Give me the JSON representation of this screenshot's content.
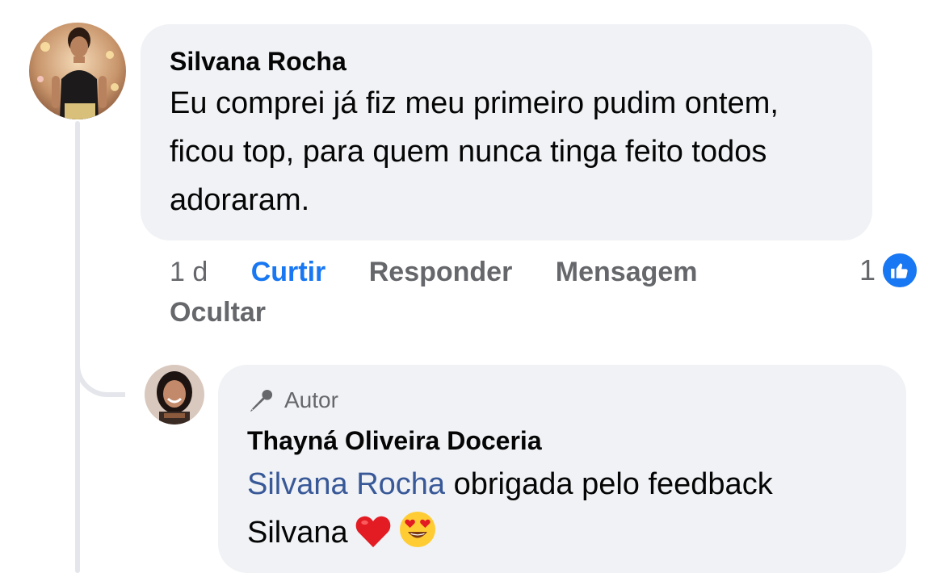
{
  "comment": {
    "author": "Silvana Rocha",
    "text": "Eu comprei já fiz meu primeiro pudim ontem, ficou top, para quem nunca tinga feito todos adoraram.",
    "actions": {
      "time": "1 d",
      "like_label": "Curtir",
      "reply_label": "Responder",
      "message_label": "Mensagem",
      "hide_label": "Ocultar"
    },
    "reaction_count": "1",
    "reaction_icon": "thumbs-up-icon",
    "like_color": "#1877f2"
  },
  "reply": {
    "badge_label": "Autor",
    "badge_icon": "microphone-icon",
    "author": "Thayná Oliveira Doceria",
    "mention": "Silvana Rocha",
    "text": "obrigada pelo feedback Silvana",
    "emojis": [
      "heart-icon",
      "heart-eyes-emoji-icon"
    ]
  }
}
